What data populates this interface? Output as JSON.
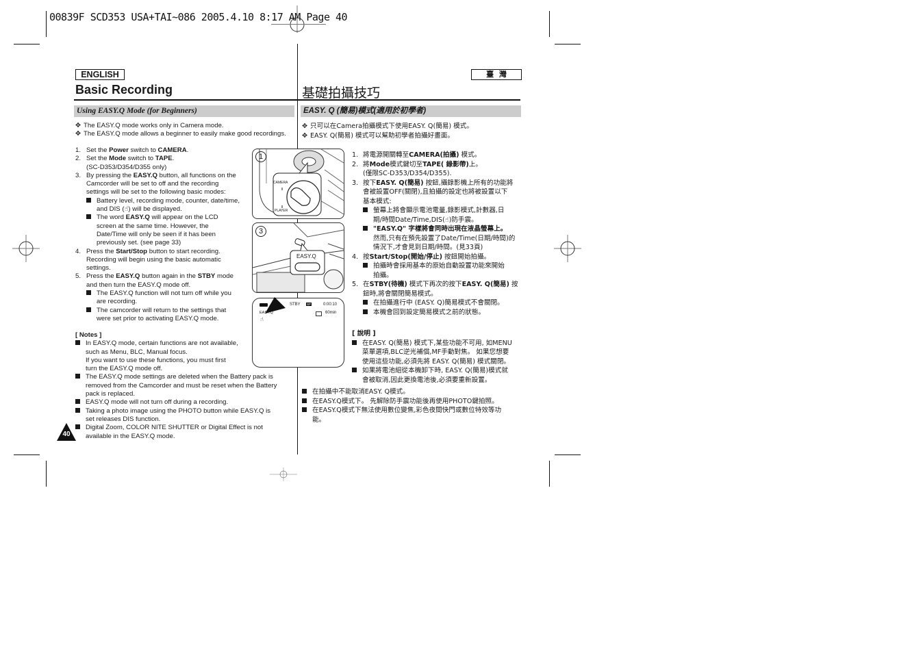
{
  "print_header": "00839F SCD353 USA+TAI~086  2005.4.10 8:17 AM Page 40",
  "left": {
    "language_tag": "ENGLISH",
    "page_title": "Basic Recording",
    "section_title": "Using EASY.Q Mode (for Beginners)",
    "intro_bullets": [
      "The EASY.Q mode works only in Camera mode.",
      "The EASY.Q mode allows a beginner to easily make good recordings."
    ],
    "steps": {
      "s1": {
        "num": "1.",
        "a": "Set the ",
        "b1": "Power",
        "c": " switch to ",
        "b2": "CAMERA",
        "d": "."
      },
      "s2": {
        "num": "2.",
        "a": "Set the ",
        "b1": "Mode",
        "c": " switch to ",
        "b2": "TAPE",
        "d": ".",
        "note": "(SC-D353/D354/D355 only)"
      },
      "s3": {
        "num": "3.",
        "a": "By pressing the ",
        "b1": "EASY.Q",
        "c": " button, all functions on the",
        "l2": "Camcorder will be set to off and the recording",
        "l3": "settings will be set to the following basic modes:",
        "sub1_l1": "Battery level, recording mode, counter, date/time,",
        "sub1_l2": "and DIS (☝) will be displayed.",
        "sub2_a": "The word ",
        "sub2_b": "EASY.Q",
        "sub2_c": " will appear on the LCD",
        "sub2_l2": "screen at the same time. However, the",
        "sub2_l3": "Date/Time will only be seen if it has been",
        "sub2_l4": "previously set. (see page 33)"
      },
      "s4": {
        "num": "4.",
        "a": "Press the ",
        "b1": "Start/Stop",
        "c": " button to start recording.",
        "l2": "Recording will begin using the basic automatic",
        "l3": "settings."
      },
      "s5": {
        "num": "5.",
        "a": "Press the ",
        "b1": "EASY.Q",
        "c": " button again in the ",
        "b2": "STBY",
        "d": " mode",
        "l2": "and then turn the EASY.Q mode off.",
        "sub1_l1": "The EASY.Q function will not turn off while you",
        "sub1_l2": "are recording.",
        "sub2_l1": "The camcorder will return to the settings that",
        "sub2_l2": "were set prior to activating EASY.Q mode."
      }
    },
    "notes_heading": "[ Notes ]",
    "notes": [
      [
        "In EASY.Q mode, certain functions are not available,",
        "such as Menu, BLC, Manual focus.",
        "If you want to use these functions, you must first",
        "turn the EASY.Q mode off."
      ],
      [
        "The EASY.Q mode settings are deleted when the Battery pack is",
        "removed from the Camcorder and must be reset when the Battery",
        "pack is replaced."
      ],
      [
        "EASY.Q mode will not turn off during a recording."
      ],
      [
        "Taking a photo image using the PHOTO button while EASY.Q is",
        "set releases DIS function."
      ],
      [
        "Digital Zoom, COLOR NITE SHUTTER or Digital Effect is not",
        "available in the EASY.Q mode."
      ]
    ],
    "page_number": "40"
  },
  "figures": {
    "fig1": {
      "step": "1",
      "label_camera": "CAMERA",
      "label_player": "PLAYER"
    },
    "fig3": {
      "step": "3",
      "button_label": "EASY.Q"
    },
    "lcd": {
      "stby": "STBY",
      "mode": "SP",
      "counter": "0:00:10",
      "easyq": "EASY.Q",
      "remaining": "60min"
    }
  },
  "right": {
    "language_tag": "臺  灣",
    "page_title": "基礎拍攝技巧",
    "section_title": "EASY. Q (簡易)模式(適用於初學者)",
    "intro_bullets": [
      "只可以在Camera拍攝模式下使用EASY. Q(簡易) 模式。",
      "EASY. Q(簡易) 模式可以幫助初學者拍攝好畫面。"
    ],
    "lines": [
      {
        "num": "1.",
        "a": "將電源開關轉至",
        "b": "CAMERA(拍攝)",
        "c": " 模式。"
      },
      {
        "num": "2.",
        "a": "將",
        "b": "Mode",
        "c": "模式鍵切至",
        "b2": "TAPE( 錄影帶)",
        "d": "上。"
      },
      {
        "num": "",
        "a": "(僅限SC-D353/D354/D355)."
      },
      {
        "num": "3.",
        "a": "按下",
        "b": "EASY. Q(簡易)",
        "c": " 按鈕,攝錄影機上所有的功能將"
      },
      {
        "num": "",
        "a": "會被設置OFF(關閉),且拍攝的設定也將被設置以下"
      },
      {
        "num": "",
        "a": "基本模式:"
      }
    ],
    "sub3": [
      [
        "螢幕上將會顯示電池電量,錄影模式,計數器,日",
        "期/時間Date/Time,DIS(☝)防手震。"
      ],
      [
        "\"EASY.Q\" 字樣將會同時出現在液晶螢幕上。",
        "然而,只有在預先設置了Date/Time(日期/時間)的",
        "情況下,才會見到日期/時間。(見33頁)"
      ]
    ],
    "step4": {
      "num": "4.",
      "a": "按",
      "b": "Start/Stop(開始/停止)",
      "c": " 按鈕開始拍攝。"
    },
    "sub4": [
      "拍攝時會採用基本的原始自動設置功能來開始",
      "拍攝。"
    ],
    "step5": {
      "num": "5.",
      "a": "在",
      "b": "STBY(待機)",
      "c": " 模式下再次的按下",
      "b2": "EASY. Q(簡易)",
      "d": " 按",
      "l2": "鈕時,將會關閉簡易模式。"
    },
    "sub5": [
      "在拍攝進行中 (EASY. Q)簡易模式不會關閉。",
      "本機會回到設定簡易模式之前的狀態。"
    ],
    "notes_heading": "[ 說明 ]",
    "notes": [
      [
        "在EASY. Q(簡易) 模式下,某些功能不可用, 如MENU",
        "菜單選項,BLC逆光補償,MF手動對焦。 如果您想要",
        "使用這些功能,必須先將 EASY. Q(簡易) 模式關閉。"
      ],
      [
        "如果將電池組從本機卸下時, EASY. Q(簡易)模式就",
        "會被取消,因此更換電池後,必須要重新設置。"
      ]
    ],
    "outer_notes": [
      [
        "在拍攝中不能取消EASY. Q模式。"
      ],
      [
        "在EASY.Q模式下。 先解除防手震功能後再使用PHOTO鍵拍照。"
      ],
      [
        "在EASY.Q模式下無法使用數位變焦,彩色夜間快門或數位特效等功",
        "能。"
      ]
    ]
  }
}
